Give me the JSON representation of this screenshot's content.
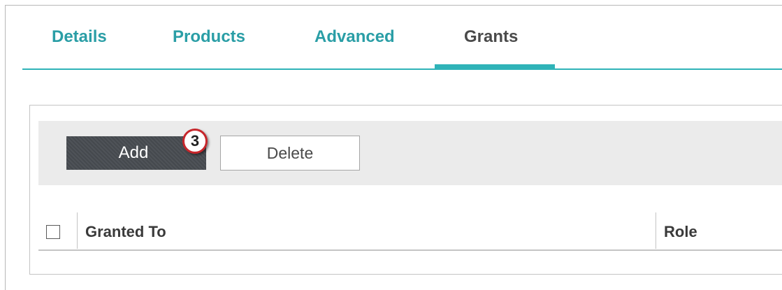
{
  "tabs": [
    {
      "label": "Details",
      "active": false
    },
    {
      "label": "Products",
      "active": false
    },
    {
      "label": "Advanced",
      "active": false
    },
    {
      "label": "Grants",
      "active": true
    }
  ],
  "toolbar": {
    "add_label": "Add",
    "delete_label": "Delete",
    "step_badge": "3"
  },
  "table": {
    "columns": [
      "Granted To",
      "Role"
    ],
    "select_all_checked": false
  },
  "colors": {
    "accent": "#2fb3b8",
    "tab_text": "#2a9ea6",
    "badge_border": "#c7262b"
  }
}
